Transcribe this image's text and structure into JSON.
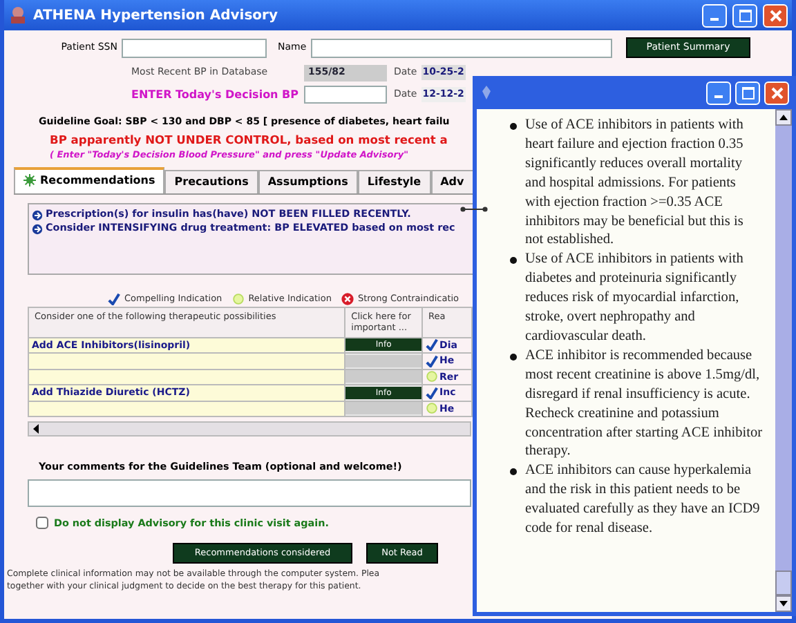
{
  "window": {
    "title": "ATHENA Hypertension Advisory"
  },
  "patient": {
    "ssn_label": "Patient SSN",
    "name_label": "Name",
    "summary_button": "Patient Summary",
    "recent_bp_label": "Most Recent BP in Database",
    "recent_bp": "155/82",
    "recent_date_label": "Date",
    "recent_date": "10-25-2",
    "today_bp_label": "ENTER Today's Decision BP",
    "today_date_label": "Date",
    "today_date": "12-12-2"
  },
  "guideline_goal": "Guideline Goal:  SBP < 130 and DBP < 85 [ presence of diabetes, heart failu",
  "status": "BP apparently NOT UNDER CONTROL, based on most recent a",
  "hint": "( Enter \"Today's Decision Blood Pressure\" and press \"Update Advisory\"",
  "tabs": [
    {
      "label": "Recommendations",
      "selected": true
    },
    {
      "label": "Precautions",
      "selected": false
    },
    {
      "label": "Assumptions",
      "selected": false
    },
    {
      "label": "Lifestyle",
      "selected": false
    },
    {
      "label": "Adv",
      "selected": false
    }
  ],
  "messages": [
    "Prescription(s) for insulin has(have) NOT BEEN FILLED RECENTLY.",
    "Consider INTENSIFYING drug treatment: BP ELEVATED based on most rec"
  ],
  "legend": [
    {
      "kind": "check",
      "label": "Compelling Indication"
    },
    {
      "kind": "circle",
      "label": "Relative Indication"
    },
    {
      "kind": "cross",
      "label": "Strong Contraindicatio"
    }
  ],
  "table": {
    "columns": [
      "Consider one of the following therapeutic possibilities",
      "Click here for important ...",
      "Rea"
    ],
    "rows": [
      {
        "therapy": "Add ACE Inhibitors(lisinopril)",
        "info": "Info",
        "kind": "check",
        "reason": "Dia"
      },
      {
        "kind": "check",
        "reason": "He"
      },
      {
        "kind": "circle",
        "reason": "Rer"
      },
      {
        "therapy": "Add Thiazide Diuretic (HCTZ)",
        "info": "Info",
        "kind": "check",
        "reason": "Inc"
      },
      {
        "kind": "circle",
        "reason": "He"
      }
    ]
  },
  "comments": {
    "label": "Your comments for the Guidelines Team (optional and welcome!)"
  },
  "do_not_display": {
    "label": "Do not display Advisory for this clinic visit again.",
    "checked": false
  },
  "buttons": [
    "Recommendations considered",
    "Not Read"
  ],
  "disclaimer": [
    "Complete clinical information may not be available through the computer system. Plea",
    "together with your clinical judgment to decide on the best therapy for this patient."
  ],
  "popup": {
    "items": [
      "Use of ACE inhibitors in patients with heart failure and ejection fraction 0.35 significantly reduces overall mortality and hospital admissions. For patients with ejection fraction >=0.35 ACE inhibitors may be beneficial but this is not established.",
      "Use of ACE inhibitors in patients with diabetes and proteinuria significantly reduces risk of myocardial infarction, stroke, overt nephropathy and cardiovascular death.",
      "ACE inhibitor is recommended because most recent creatinine is above 1.5mg/dl, disregard if renal insufficiency is acute. Recheck creatinine and potassium concentration after starting ACE inhibitor therapy.",
      "ACE inhibitors can cause hyperkalemia and the risk in this patient needs to be evaluated carefully as they have an ICD9 code for renal disease."
    ]
  }
}
